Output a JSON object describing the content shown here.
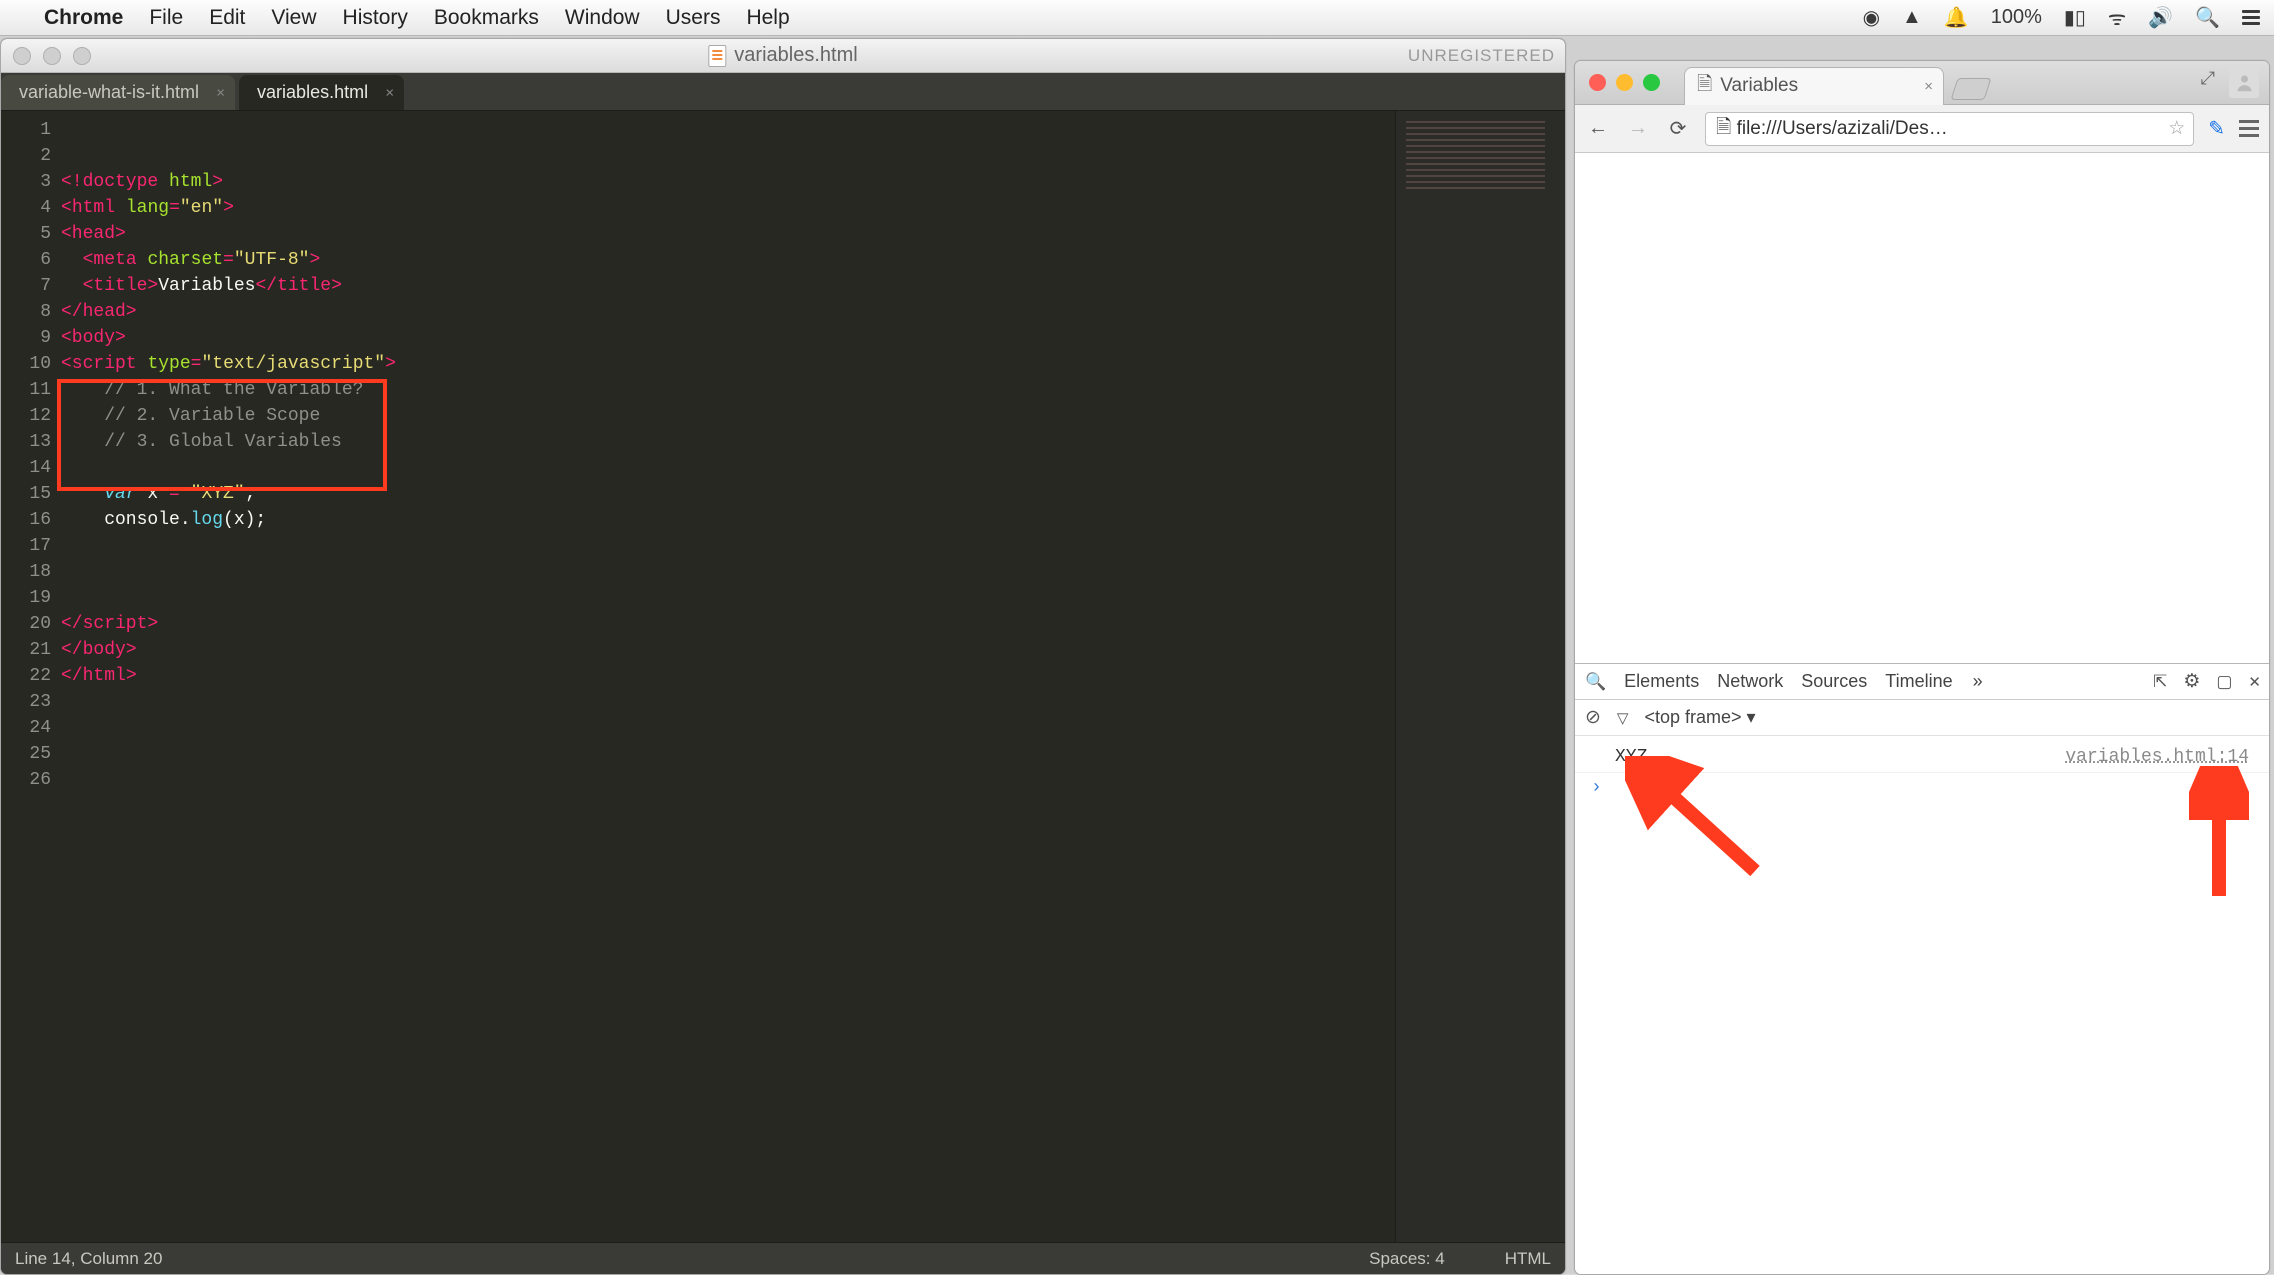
{
  "menubar": {
    "app": "Chrome",
    "items": [
      "File",
      "Edit",
      "View",
      "History",
      "Bookmarks",
      "Window",
      "Users",
      "Help"
    ],
    "battery": "100%"
  },
  "sublime": {
    "title": "variables.html",
    "badge": "UNREGISTERED",
    "tabs": [
      {
        "label": "variable-what-is-it.html",
        "active": false
      },
      {
        "label": "variables.html",
        "active": true
      }
    ],
    "code": {
      "lines": [
        {
          "n": 1,
          "html": "<span class='pk'>&lt;!doctype</span> <span class='gr'>html</span><span class='pk'>&gt;</span>"
        },
        {
          "n": 2,
          "html": "<span class='pk'>&lt;</span><span class='pk'>html</span> <span class='gr'>lang</span><span class='pk'>=</span><span class='ye'>\"en\"</span><span class='pk'>&gt;</span>"
        },
        {
          "n": 3,
          "html": "<span class='pk'>&lt;head&gt;</span>"
        },
        {
          "n": 4,
          "html": "  <span class='pk'>&lt;meta</span> <span class='gr'>charset</span><span class='pk'>=</span><span class='ye'>\"UTF-8\"</span><span class='pk'>&gt;</span>"
        },
        {
          "n": 5,
          "html": "  <span class='pk'>&lt;title&gt;</span>Variables<span class='pk'>&lt;/</span><span class='pk'>title</span><span class='pk'>&gt;</span>"
        },
        {
          "n": 6,
          "html": "<span class='pk'>&lt;/head&gt;</span>"
        },
        {
          "n": 7,
          "html": "<span class='pk'>&lt;body&gt;</span>"
        },
        {
          "n": 8,
          "html": "<span class='pk'>&lt;script</span> <span class='gr'>type</span><span class='pk'>=</span><span class='ye'>\"text/javascript\"</span><span class='pk'>&gt;</span>"
        },
        {
          "n": 9,
          "html": "    <span class='cm'>// 1. What the Variable?</span>"
        },
        {
          "n": 10,
          "html": "    <span class='cm'>// 2. Variable Scope</span>"
        },
        {
          "n": 11,
          "html": "    <span class='cm'>// 3. Global Variables</span>"
        },
        {
          "n": 12,
          "html": ""
        },
        {
          "n": 13,
          "html": "    <span class='bl'>var</span> x <span class='pk'>=</span> <span class='ye'>\"XYZ\"</span>;"
        },
        {
          "n": 14,
          "html": "    console.<span class='cy'>log</span>(x);"
        },
        {
          "n": 15,
          "html": ""
        },
        {
          "n": 16,
          "html": ""
        },
        {
          "n": 17,
          "html": ""
        },
        {
          "n": 18,
          "html": "<span class='pk'>&lt;/script&gt;</span>"
        },
        {
          "n": 19,
          "html": "<span class='pk'>&lt;/body&gt;</span>"
        },
        {
          "n": 20,
          "html": "<span class='pk'>&lt;/</span><span class='pk'>html</span><span class='pk'>&gt;</span>"
        },
        {
          "n": 21,
          "html": ""
        },
        {
          "n": 22,
          "html": ""
        },
        {
          "n": 23,
          "html": ""
        },
        {
          "n": 24,
          "html": ""
        },
        {
          "n": 25,
          "html": ""
        },
        {
          "n": 26,
          "html": ""
        }
      ]
    },
    "status": {
      "left": "Line 14, Column 20",
      "spaces": "Spaces: 4",
      "lang": "HTML"
    }
  },
  "chrome": {
    "tab_title": "Variables",
    "url": "file:///Users/azizali/Des…",
    "devtools": {
      "tabs": [
        "Elements",
        "Network",
        "Sources",
        "Timeline"
      ],
      "frame_label": "<top frame>",
      "console_rows": [
        {
          "msg": "XYZ",
          "src": "variables.html:14"
        }
      ]
    }
  }
}
